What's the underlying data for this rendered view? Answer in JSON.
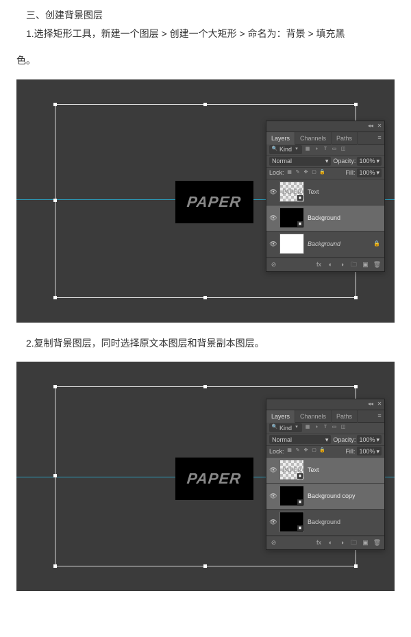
{
  "section": {
    "heading": "三、创建背景图层",
    "step1": "1.选择矩形工具，新建一个图层 > 创建一个大矩形 > 命名为：背景 > 填充黑",
    "step1_cont": "色。",
    "step2": "2.复制背景图层，同时选择原文本图层和背景副本图层。"
  },
  "canvas": {
    "text": "PAPER"
  },
  "panel": {
    "tabs": [
      "Layers",
      "Channels",
      "Paths"
    ],
    "filter_kind": "Kind",
    "blend_mode": "Normal",
    "opacity_label": "Opacity:",
    "opacity_value": "100%",
    "lock_label": "Lock:",
    "fill_label": "Fill:",
    "fill_value": "100%"
  },
  "screenshot1": {
    "layers": [
      {
        "name": "Text",
        "visible": true,
        "selected": false
      },
      {
        "name": "Background",
        "visible": true,
        "selected": true
      },
      {
        "name": "Background",
        "visible": true,
        "selected": false,
        "locked": true
      }
    ]
  },
  "screenshot2": {
    "layers": [
      {
        "name": "Text",
        "visible": true,
        "selected": true
      },
      {
        "name": "Background copy",
        "visible": true,
        "selected": true
      },
      {
        "name": "Background",
        "visible": true,
        "selected": false
      }
    ]
  }
}
